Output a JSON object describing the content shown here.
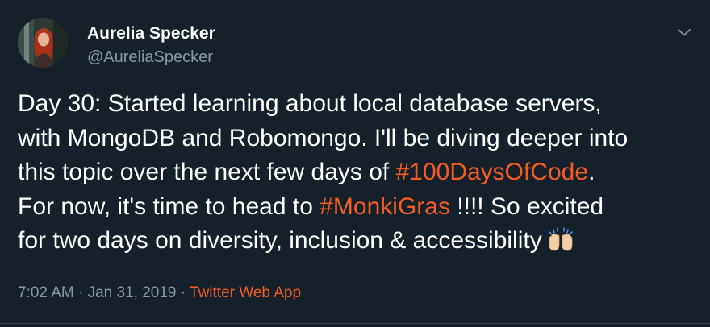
{
  "author": {
    "display_name": "Aurelia Specker",
    "handle": "@AureliaSpecker"
  },
  "tweet": {
    "line1": "Day 30: Started learning about local database servers,",
    "line2": "with MongoDB and Robomongo. I'll be diving deeper into",
    "line3_pre": "this topic over the next few days of ",
    "hashtag1": "#100DaysOfCode",
    "line3_post": ".",
    "line4_pre": "For now, it's time to head to ",
    "hashtag2": "#MonkiGras",
    "line4_post": " !!!! So excited",
    "line5": "for two days on diversity, inclusion & accessibility",
    "emoji": "raising-hands-emoji"
  },
  "meta": {
    "time": "7:02 AM",
    "separator1": " · ",
    "date": "Jan 31, 2019",
    "separator2": " · ",
    "source": "Twitter Web App"
  },
  "colors": {
    "background": "#15202b",
    "accent": "#f45d22",
    "secondary_text": "#8899a6",
    "divider": "#38444d"
  },
  "icons": {
    "menu": "chevron-down-icon"
  }
}
